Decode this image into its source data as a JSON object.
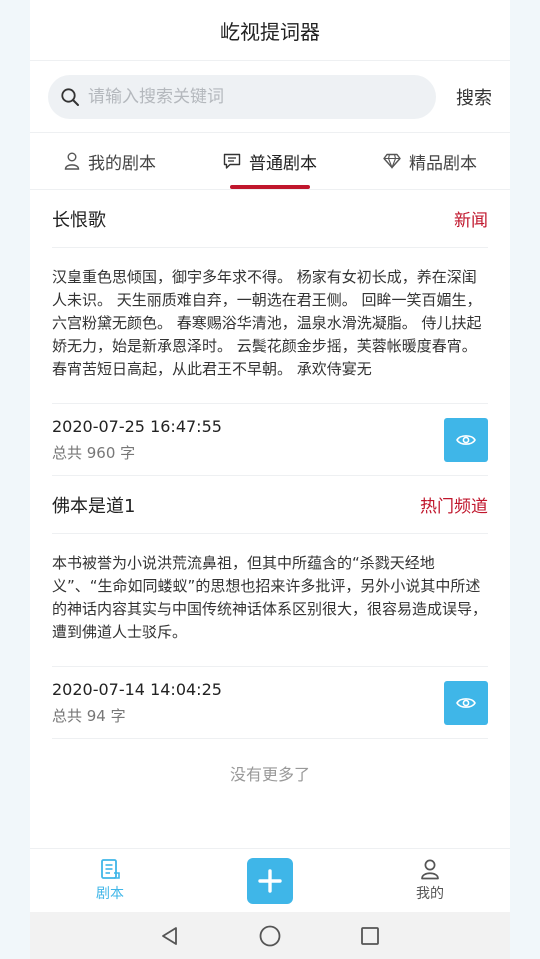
{
  "app": {
    "title": "屹视提词器"
  },
  "search": {
    "placeholder": "请输入搜索关键词",
    "button_label": "搜索"
  },
  "tabs": [
    {
      "label": "我的剧本",
      "icon": "user-icon",
      "active": false
    },
    {
      "label": "普通剧本",
      "icon": "message-icon",
      "active": true
    },
    {
      "label": "精品剧本",
      "icon": "diamond-icon",
      "active": false
    }
  ],
  "scripts": [
    {
      "title": "长恨歌",
      "tag": "新闻",
      "content": "汉皇重色思倾国，御宇多年求不得。 杨家有女初长成，养在深闺人未识。 天生丽质难自弃，一朝选在君王侧。 回眸一笑百媚生，六宫粉黛无颜色。 春寒赐浴华清池，温泉水滑洗凝脂。 侍儿扶起娇无力，始是新承恩泽时。 云鬓花颜金步摇，芙蓉帐暖度春宵。 春宵苦短日高起，从此君王不早朝。 承欢侍宴无",
      "date": "2020-07-25 16:47:55",
      "word_count": "总共 960 字"
    },
    {
      "title": "佛本是道1",
      "tag": "热门频道",
      "content": "本书被誉为小说洪荒流鼻祖，但其中所蕴含的“杀戮天经地义”、“生命如同蝼蚁”的思想也招来许多批评，另外小说其中所述的神话内容其实与中国传统神话体系区别很大，很容易造成误导，遭到佛道人士驳斥。",
      "date": "2020-07-14 14:04:25",
      "word_count": "总共 94 字"
    }
  ],
  "list_footer": "没有更多了",
  "bottom_nav": {
    "scripts_label": "剧本",
    "mine_label": "我的"
  },
  "colors": {
    "accent": "#3fb6e8",
    "tag_red": "#c0162c"
  }
}
